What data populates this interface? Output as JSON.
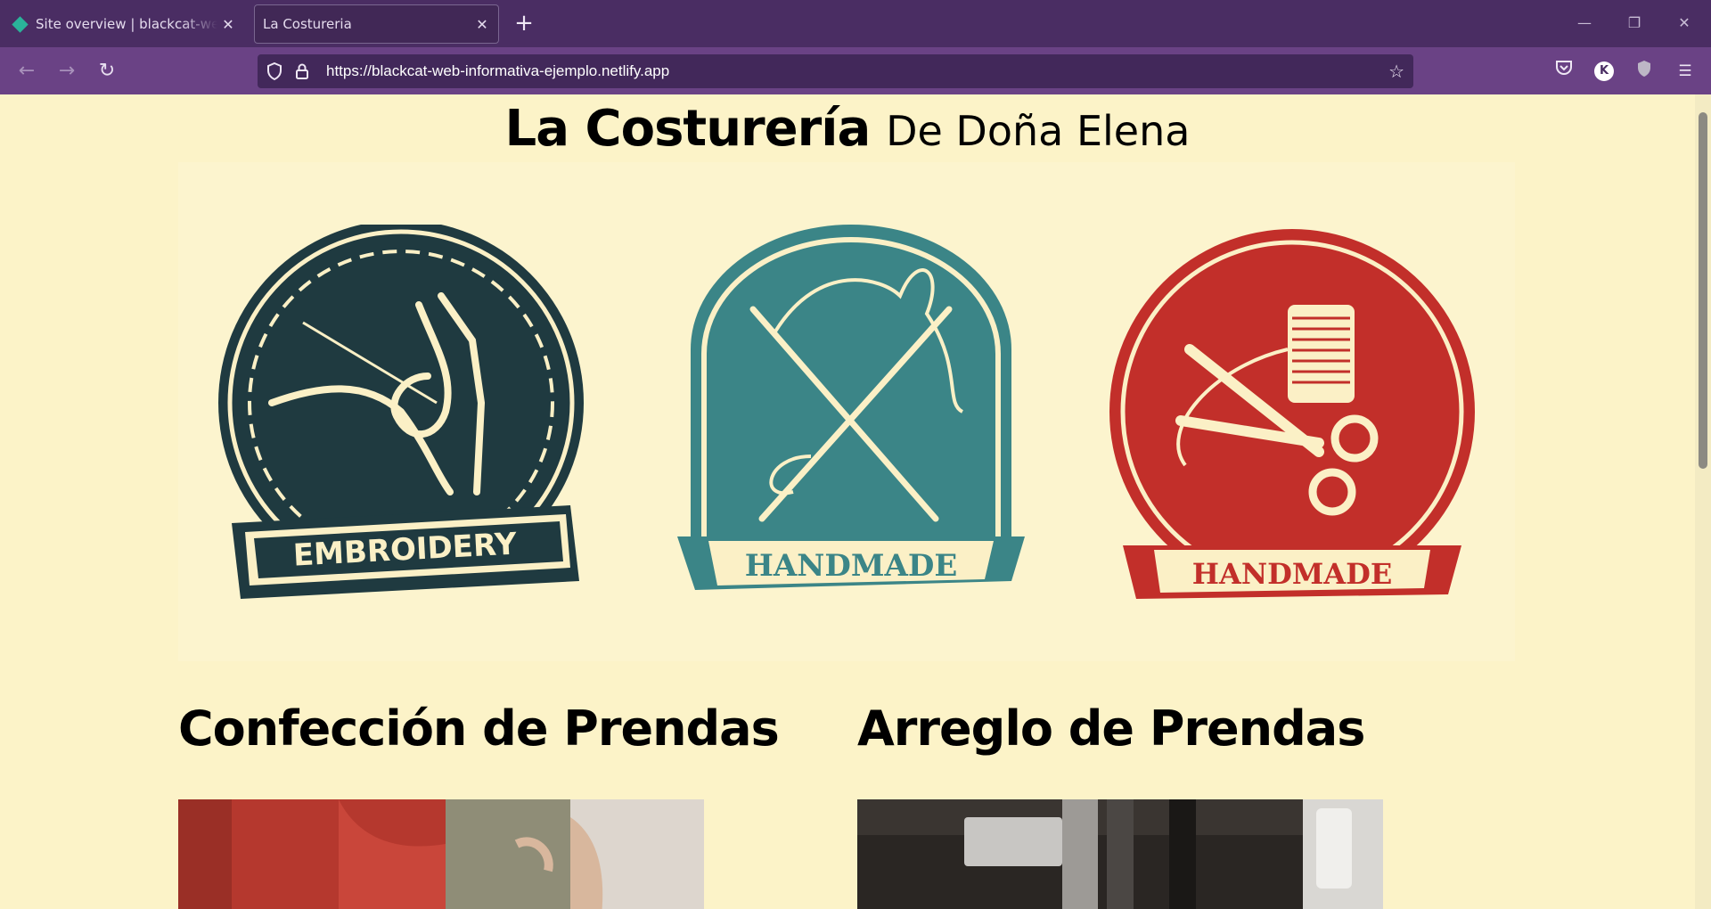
{
  "browser": {
    "tabs": [
      {
        "title": "Site overview | blackcat-web-informativa-ejemplo",
        "active": false
      },
      {
        "title": "La Costureria",
        "active": true
      }
    ],
    "url": "https://blackcat-web-informativa-ejemplo.netlify.app",
    "profile_initial": "K"
  },
  "page": {
    "title_bold": "La Costurería",
    "title_light": "De Doña Elena",
    "badges": [
      {
        "text": "EMBROIDERY",
        "color": "#1f3a40"
      },
      {
        "text": "HANDMADE",
        "color": "#3b8587"
      },
      {
        "text": "HANDMADE",
        "color": "#c22f2a"
      }
    ],
    "services": [
      {
        "heading": "Confección de Prendas"
      },
      {
        "heading": "Arreglo de Prendas"
      }
    ]
  },
  "colors": {
    "chrome_tabbar": "#4a2d63",
    "chrome_navbar": "#6a4285",
    "page_bg": "#fcf3c8",
    "cream": "#fbf0c6"
  }
}
